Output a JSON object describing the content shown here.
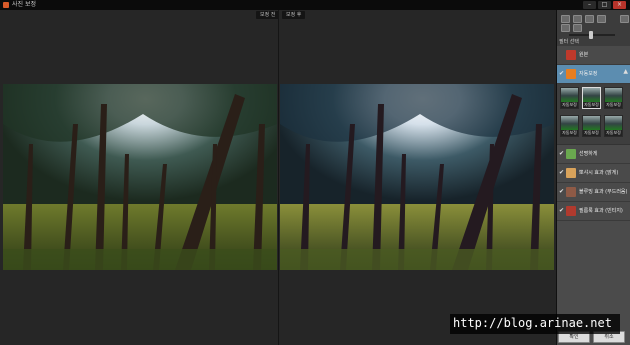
{
  "window": {
    "title": "사진 보정"
  },
  "canvas": {
    "before_label": "보정 전",
    "after_label": "보정 후"
  },
  "panel": {
    "subheader": "필터 선택",
    "filters": [
      {
        "label": "원본",
        "checked": false,
        "selected": false,
        "thumb_color": "#c0392b"
      },
      {
        "label": "자동보정",
        "checked": true,
        "selected": true,
        "thumb_color": "#e67e22"
      },
      {
        "label": "선명하게",
        "checked": true,
        "selected": false,
        "thumb_color": "#6aa84f"
      },
      {
        "label": "뽀샤시 효과 (밝게)",
        "checked": true,
        "selected": false,
        "thumb_color": "#d9a35b"
      },
      {
        "label": "블루밍 효과 (부드러움)",
        "checked": true,
        "selected": false,
        "thumb_color": "#8e5a46"
      },
      {
        "label": "필름룩 효과 (빈티지)",
        "checked": true,
        "selected": false,
        "thumb_color": "#b03a2e"
      }
    ],
    "presets": [
      {
        "label": "자동보정"
      },
      {
        "label": "자동보정"
      },
      {
        "label": "자동보정"
      },
      {
        "label": "자동보정"
      },
      {
        "label": "자동보정"
      },
      {
        "label": "자동보정"
      }
    ]
  },
  "buttons": {
    "ok": "확인",
    "cancel": "취소"
  },
  "watermark": "http://blog.arinae.net",
  "colors": {
    "selected": "#5c8db0",
    "background": "#262626"
  }
}
